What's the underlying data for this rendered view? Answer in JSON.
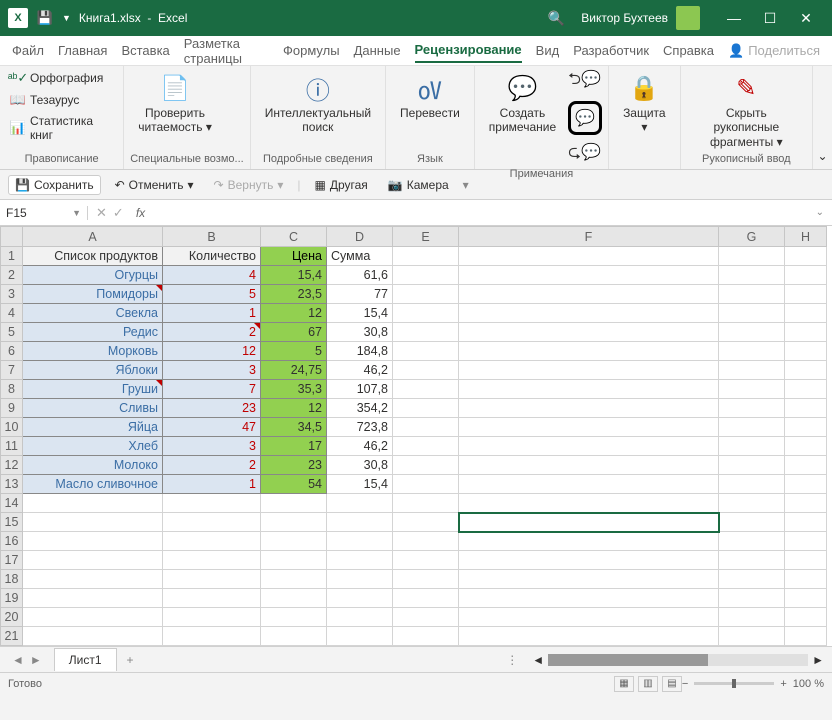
{
  "titlebar": {
    "filename": "Книга1.xlsx",
    "app": "Excel",
    "user": "Виктор Бухтеев"
  },
  "tabs": {
    "items": [
      "Файл",
      "Главная",
      "Вставка",
      "Разметка страницы",
      "Формулы",
      "Данные",
      "Рецензирование",
      "Вид",
      "Разработчик",
      "Справка"
    ],
    "active": "Рецензирование",
    "share": "Поделиться"
  },
  "ribbon": {
    "g1": {
      "label": "Правописание",
      "spell": "Орфография",
      "thes": "Тезаурус",
      "stat": "Статистика книг"
    },
    "g2": {
      "label": "Специальные возмо...",
      "read": "Проверить",
      "read2": "читаемость"
    },
    "g3": {
      "label": "Подробные сведения",
      "smart": "Интеллектуальный",
      "smart2": "поиск"
    },
    "g4": {
      "label": "Язык",
      "trans": "Перевести"
    },
    "g5": {
      "label": "Примечания",
      "new": "Создать",
      "new2": "примечание"
    },
    "g6": {
      "label": "",
      "protect": "Защита"
    },
    "g7": {
      "label": "Рукописный ввод",
      "ink": "Скрыть рукописные",
      "ink2": "фрагменты"
    }
  },
  "qat": {
    "save": "Сохранить",
    "undo": "Отменить",
    "redo": "Вернуть",
    "other": "Другая",
    "camera": "Камера"
  },
  "namebox": "F15",
  "headers": {
    "a": "Список продуктов",
    "b": "Количество",
    "c": "Цена",
    "d": "Сумма"
  },
  "cols": [
    "A",
    "B",
    "C",
    "D",
    "E",
    "F",
    "G",
    "H"
  ],
  "rows": [
    {
      "a": "Огурцы",
      "b": "4",
      "c": "15,4",
      "d": "61,6"
    },
    {
      "a": "Помидоры",
      "b": "5",
      "c": "23,5",
      "d": "77"
    },
    {
      "a": "Свекла",
      "b": "1",
      "c": "12",
      "d": "15,4"
    },
    {
      "a": "Редис",
      "b": "2",
      "c": "67",
      "d": "30,8"
    },
    {
      "a": "Морковь",
      "b": "12",
      "c": "5",
      "d": "184,8"
    },
    {
      "a": "Яблоки",
      "b": "3",
      "c": "24,75",
      "d": "46,2"
    },
    {
      "a": "Груши",
      "b": "7",
      "c": "35,3",
      "d": "107,8"
    },
    {
      "a": "Сливы",
      "b": "23",
      "c": "12",
      "d": "354,2"
    },
    {
      "a": "Яйца",
      "b": "47",
      "c": "34,5",
      "d": "723,8"
    },
    {
      "a": "Хлеб",
      "b": "3",
      "c": "17",
      "d": "46,2"
    },
    {
      "a": "Молоко",
      "b": "2",
      "c": "23",
      "d": "30,8"
    },
    {
      "a": "Масло сливочное",
      "b": "1",
      "c": "54",
      "d": "15,4"
    }
  ],
  "sheet_tab": "Лист1",
  "status": {
    "ready": "Готово",
    "zoom": "100 %"
  },
  "chart_data": {
    "type": "table",
    "title": "Список продуктов",
    "columns": [
      "Список продуктов",
      "Количество",
      "Цена",
      "Сумма"
    ],
    "data": [
      [
        "Огурцы",
        4,
        15.4,
        61.6
      ],
      [
        "Помидоры",
        5,
        23.5,
        77
      ],
      [
        "Свекла",
        1,
        12,
        15.4
      ],
      [
        "Редис",
        2,
        67,
        30.8
      ],
      [
        "Морковь",
        12,
        5,
        184.8
      ],
      [
        "Яблоки",
        3,
        24.75,
        46.2
      ],
      [
        "Груши",
        7,
        35.3,
        107.8
      ],
      [
        "Сливы",
        23,
        12,
        354.2
      ],
      [
        "Яйца",
        47,
        34.5,
        723.8
      ],
      [
        "Хлеб",
        3,
        17,
        46.2
      ],
      [
        "Молоко",
        2,
        23,
        30.8
      ],
      [
        "Масло сливочное",
        1,
        54,
        15.4
      ]
    ]
  }
}
